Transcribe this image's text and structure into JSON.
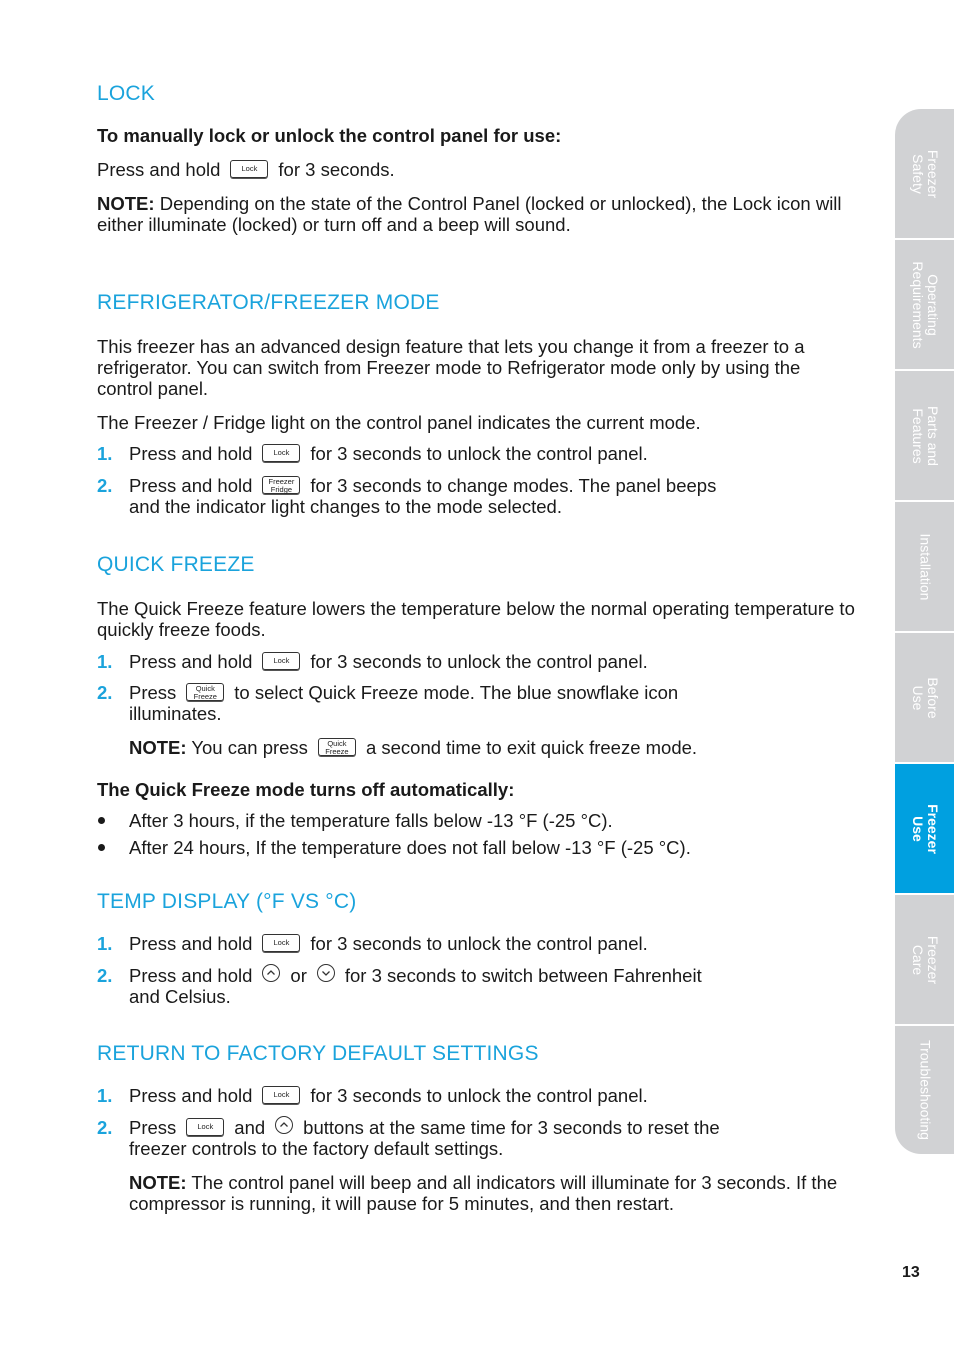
{
  "colors": {
    "accent": "#1aa3dc",
    "tab_inactive": "#d1d2d4",
    "tab_active": "#00a0e0",
    "text": "#1a1a1a"
  },
  "lock": {
    "heading": "LOCK",
    "subheading": "To manually lock or unlock the control panel for use:",
    "press_pre": "Press and hold",
    "press_post": "for 3 seconds.",
    "note_label": "NOTE:",
    "note_text": " Depending on the state of the Control Panel (locked or unlocked), the Lock icon will either illuminate (locked) or turn off and a beep will sound."
  },
  "buttons": {
    "lock": "Lock",
    "freezer_fridge_1": "Freezer",
    "freezer_fridge_2": "Fridge",
    "quick_freeze_1": "Quick",
    "quick_freeze_2": "Freeze",
    "up_icon": "chevron-up-circle-icon",
    "down_icon": "chevron-down-circle-icon"
  },
  "mode": {
    "heading": "REFRIGERATOR/FREEZER MODE",
    "para1": "This freezer has an advanced design feature that lets you change it from a freezer to a refrigerator. You can switch from Freezer mode to Refrigerator mode only by using the control panel.",
    "para2": "The Freezer / Fridge light on the control panel indicates the current mode.",
    "steps": [
      {
        "num": "1.",
        "pre": "Press and hold",
        "post": "for 3 seconds to unlock the control panel."
      },
      {
        "num": "2.",
        "pre": "Press and hold",
        "post": "for 3 seconds to change modes. The panel beeps",
        "cont": "and the indicator light changes to the mode selected."
      }
    ]
  },
  "quick_freeze": {
    "heading": "QUICK FREEZE",
    "para1": "The Quick Freeze feature lowers the temperature below the normal operating temperature to quickly freeze foods.",
    "steps": [
      {
        "num": "1.",
        "pre": "Press and hold",
        "post": "for 3 seconds to unlock the control panel."
      },
      {
        "num": "2.",
        "pre": "Press",
        "post": "to select Quick Freeze mode. The blue snowflake icon",
        "cont": "illuminates."
      }
    ],
    "note_label": "NOTE:",
    "note_pre": " You can press",
    "note_post": "a second time to exit quick freeze mode.",
    "auto_heading": "The Quick Freeze mode turns off automatically:",
    "bullets": [
      "After 3 hours, if the temperature falls below -13 °F (-25 °C).",
      "After 24 hours, If the temperature does not fall below -13 °F (-25 °C)."
    ]
  },
  "temp_display": {
    "heading": "TEMP DISPLAY (°F VS °C)",
    "steps": [
      {
        "num": "1.",
        "pre": "Press and hold",
        "post": "for 3 seconds to unlock the control panel."
      },
      {
        "num": "2.",
        "pre": "Press and hold",
        "mid": "or",
        "post": "for 3 seconds to switch between Fahrenheit",
        "cont": "and Celsius."
      }
    ]
  },
  "factory": {
    "heading": "RETURN TO FACTORY DEFAULT SETTINGS",
    "steps": [
      {
        "num": "1.",
        "pre": "Press and hold",
        "post": "for 3 seconds to unlock the control panel."
      },
      {
        "num": "2.",
        "pre": "Press",
        "mid": "and",
        "post": "buttons at the same time for 3 seconds to reset the",
        "cont": "freezer controls to the factory default settings."
      }
    ],
    "note_label": "NOTE:",
    "note_text": " The control panel will beep and all indicators will illuminate for 3 seconds. If the compressor is running, it will pause for 5 minutes, and then restart."
  },
  "sidebar": {
    "tabs": [
      {
        "label1": "Freezer",
        "label2": "Safety",
        "active": false
      },
      {
        "label1": "Operating",
        "label2": "Requirements",
        "active": false
      },
      {
        "label1": "Parts and",
        "label2": "Features",
        "active": false
      },
      {
        "label1": "Installation",
        "label2": "",
        "active": false
      },
      {
        "label1": "Before",
        "label2": "Use",
        "active": false
      },
      {
        "label1": "Freezer",
        "label2": "Use",
        "active": true
      },
      {
        "label1": "Freezer",
        "label2": "Care",
        "active": false
      },
      {
        "label1": "Troubleshooting",
        "label2": "",
        "active": false
      }
    ]
  },
  "page_number": "13"
}
